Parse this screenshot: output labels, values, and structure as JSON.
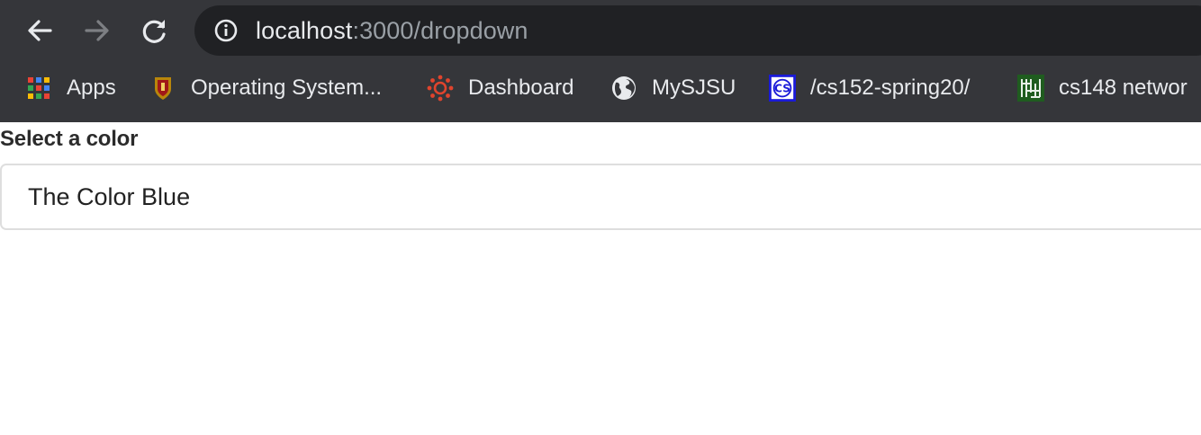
{
  "browser": {
    "url_host": "localhost",
    "url_path": ":3000/dropdown",
    "icons": {
      "back": "arrow-left-icon",
      "forward": "arrow-right-icon",
      "reload": "reload-icon",
      "site_info": "info-icon"
    }
  },
  "bookmarks": [
    {
      "label": "Apps",
      "icon": "apps-grid-icon"
    },
    {
      "label": "Operating System...",
      "icon": "crest-icon"
    },
    {
      "label": "Dashboard",
      "icon": "canvas-icon"
    },
    {
      "label": "MySJSU",
      "icon": "globe-icon"
    },
    {
      "label": "/cs152-spring20/",
      "icon": "cs-icon"
    },
    {
      "label": "cs148 networ",
      "icon": "maze-icon"
    }
  ],
  "page": {
    "label": "Select a color",
    "selected_value": "The Color Blue"
  },
  "colors": {
    "chrome_bg": "#35363a",
    "omnibox_bg": "#202124",
    "page_bg": "#ffffff"
  }
}
